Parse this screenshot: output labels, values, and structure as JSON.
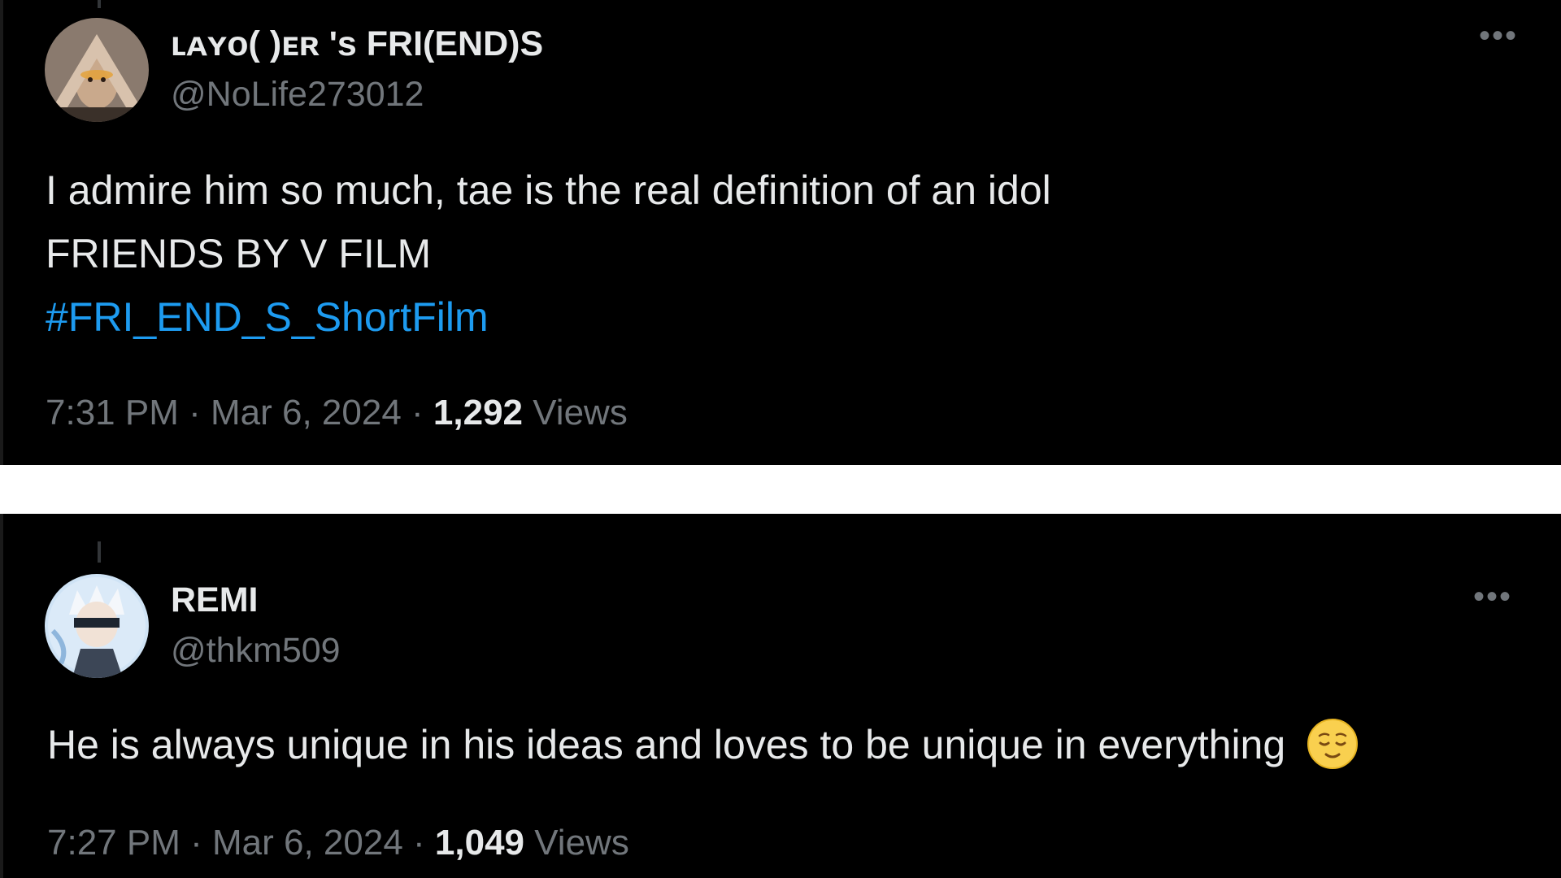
{
  "tweets": [
    {
      "display_name": "ʟᴀʏᴏ(  )ᴇʀ 's FRI(END)S",
      "handle": "@NoLife273012",
      "more_icon": "more-icon",
      "lines": [
        "I admire him so much, tae is the real definition of an idol",
        "FRIENDS BY V FILM"
      ],
      "hashtag": "#FRI_END_S_ShortFilm",
      "time": "7:31 PM",
      "sep1": " · ",
      "date": "Mar 6, 2024",
      "sep2": " · ",
      "views_count": "1,292",
      "views_label": " Views"
    },
    {
      "display_name": "REMI",
      "handle": "@thkm509",
      "more_icon": "more-icon",
      "text": "He is always unique in his ideas and loves to be unique in everything",
      "emoji": "relieved-face-emoji",
      "time": "7:27 PM",
      "sep1": " · ",
      "date": "Mar 6, 2024",
      "sep2": " · ",
      "views_count": "1,049",
      "views_label": " Views"
    }
  ],
  "colors": {
    "background": "#000000",
    "separator": "#ffffff",
    "primary_text": "#e7e9ea",
    "secondary_text": "#71767b",
    "link": "#1d9bf0"
  }
}
